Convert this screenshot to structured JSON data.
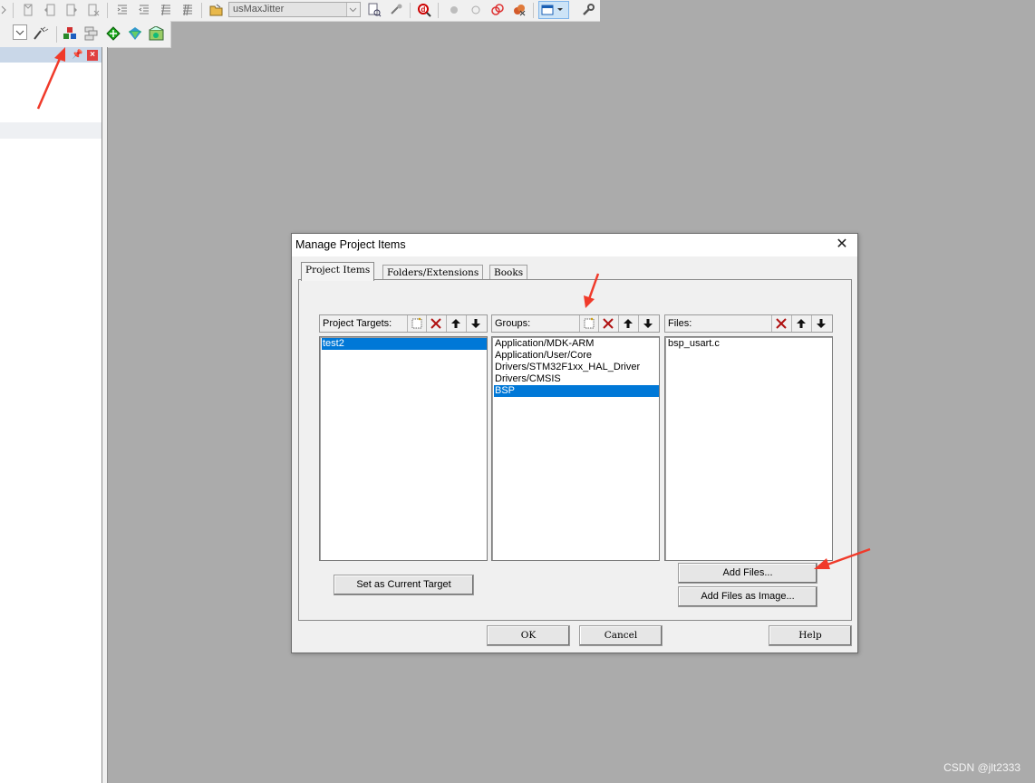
{
  "toolbar": {
    "build_target_value": "usMaxJitter"
  },
  "dialog": {
    "title": "Manage Project Items",
    "close_label": "✕",
    "tabs": [
      {
        "label": "Project Items",
        "active": true
      },
      {
        "label": "Folders/Extensions",
        "active": false
      },
      {
        "label": "Books",
        "active": false
      }
    ],
    "targets": {
      "label": "Project Targets:",
      "items": [
        "test2"
      ],
      "selected": "test2"
    },
    "groups": {
      "label": "Groups:",
      "items": [
        "Application/MDK-ARM",
        "Application/User/Core",
        "Drivers/STM32F1xx_HAL_Driver",
        "Drivers/CMSIS",
        "BSP"
      ],
      "selected": "BSP"
    },
    "files": {
      "label": "Files:",
      "items": [
        "bsp_usart.c"
      ]
    },
    "buttons": {
      "set_current_target": "Set as Current Target",
      "add_files": "Add Files...",
      "add_files_image": "Add Files as Image...",
      "ok": "OK",
      "cancel": "Cancel",
      "help": "Help"
    }
  },
  "icons": {
    "new": "new-item-icon",
    "delete": "delete-icon",
    "move_up": "move-up-icon",
    "move_down": "move-down-icon"
  },
  "colors": {
    "selection": "#0078d7",
    "annotation_arrow": "#f03a2a",
    "workspace": "#ababab"
  },
  "watermark": "CSDN @jlt2333"
}
